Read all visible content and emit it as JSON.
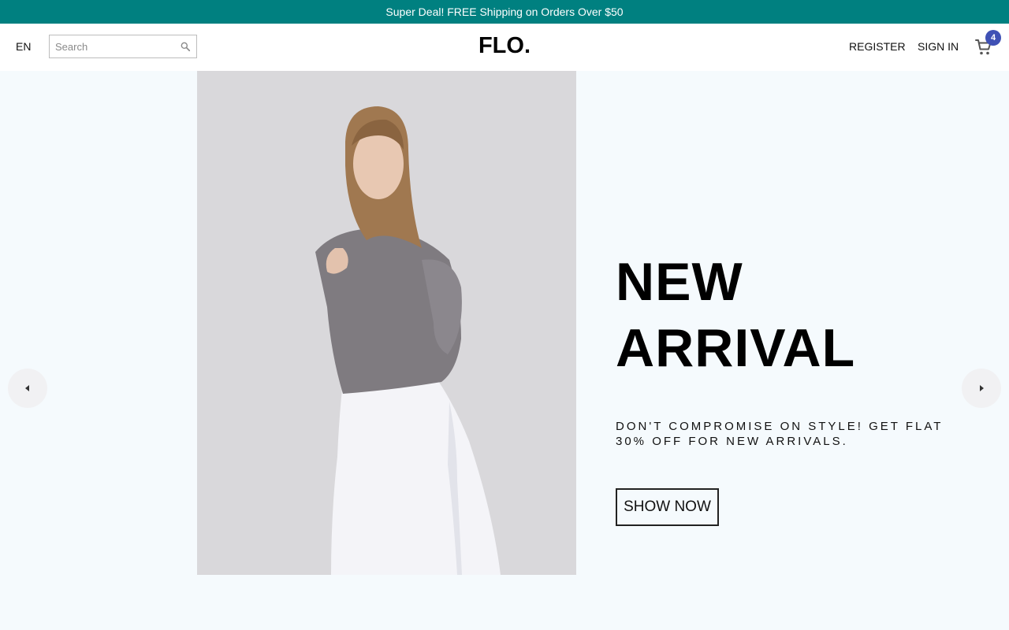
{
  "announcement": {
    "text": "Super Deal! FREE Shipping on Orders Over $50"
  },
  "header": {
    "language": "EN",
    "search": {
      "placeholder": "Search",
      "value": ""
    },
    "logo": "FLO.",
    "register_label": "REGISTER",
    "signin_label": "SIGN IN",
    "cart": {
      "count": "4"
    }
  },
  "slider": {
    "headline_line1": "NEW",
    "headline_line2": "ARRIVAL",
    "description": "DON'T COMPROMISE ON STYLE! GET FLAT 30% OFF FOR NEW ARRIVALS.",
    "button_label": "SHOW NOW"
  },
  "colors": {
    "announcement_bg": "#008080",
    "page_bg": "#f5fafd",
    "badge_bg": "#3f51b5"
  },
  "icons": {
    "search": "search-icon",
    "cart": "cart-icon",
    "prev": "arrow-left-icon",
    "next": "arrow-right-icon"
  }
}
